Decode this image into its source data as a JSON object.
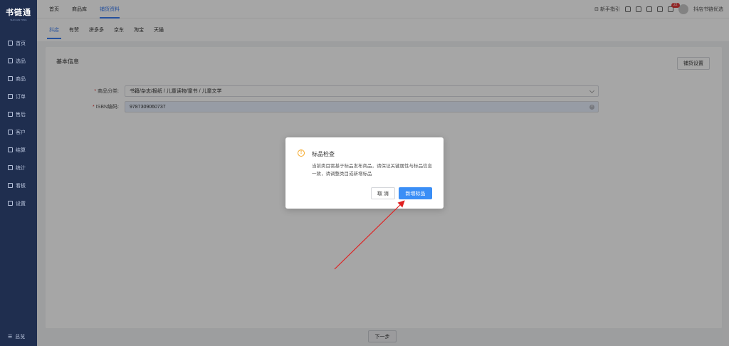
{
  "app": {
    "logo_text": "书链通",
    "logo_sub": "SHU LIAN TONG"
  },
  "sidebar": {
    "items": [
      {
        "label": "首页",
        "icon": "monitor-icon"
      },
      {
        "label": "选品",
        "icon": "cart-icon"
      },
      {
        "label": "商品",
        "icon": "box-icon"
      },
      {
        "label": "订单",
        "icon": "order-icon"
      },
      {
        "label": "售后",
        "icon": "service-icon"
      },
      {
        "label": "客户",
        "icon": "users-icon"
      },
      {
        "label": "结算",
        "icon": "settle-icon"
      },
      {
        "label": "统计",
        "icon": "chart-icon"
      },
      {
        "label": "看板",
        "icon": "dashboard-icon"
      },
      {
        "label": "设置",
        "icon": "settings-icon"
      }
    ],
    "bottom_label": "总览"
  },
  "topbar": {
    "tabs": [
      "首页",
      "商品库",
      "铺货资料"
    ],
    "active_tab": 2,
    "guide_label": "新手指引",
    "notification_count": "22",
    "shop_name": "抖店书链优选"
  },
  "subtabs": {
    "items": [
      "抖店",
      "有赞",
      "拼多多",
      "京东",
      "淘宝",
      "天猫"
    ],
    "active": 0
  },
  "card": {
    "title": "基本信息",
    "config_button": "铺货设置",
    "category_label": "商品分类:",
    "category_value": "书籍/杂志/报纸 / 儿童读物/童书 / 儿童文学",
    "isbn_label": "ISBN编码:",
    "isbn_value": "9787309060737"
  },
  "modal": {
    "title": "标品检查",
    "body": "当前类目需基于标品发布商品，请保证关键属性与标品信息一致，请调整类目或新增标品",
    "cancel_label": "取 消",
    "confirm_label": "新增标品"
  },
  "footer": {
    "next_label": "下一步"
  },
  "colors": {
    "accent": "#3a8ef6",
    "sidebar_bg": "#1f2e4f",
    "arrow": "#e02020"
  }
}
